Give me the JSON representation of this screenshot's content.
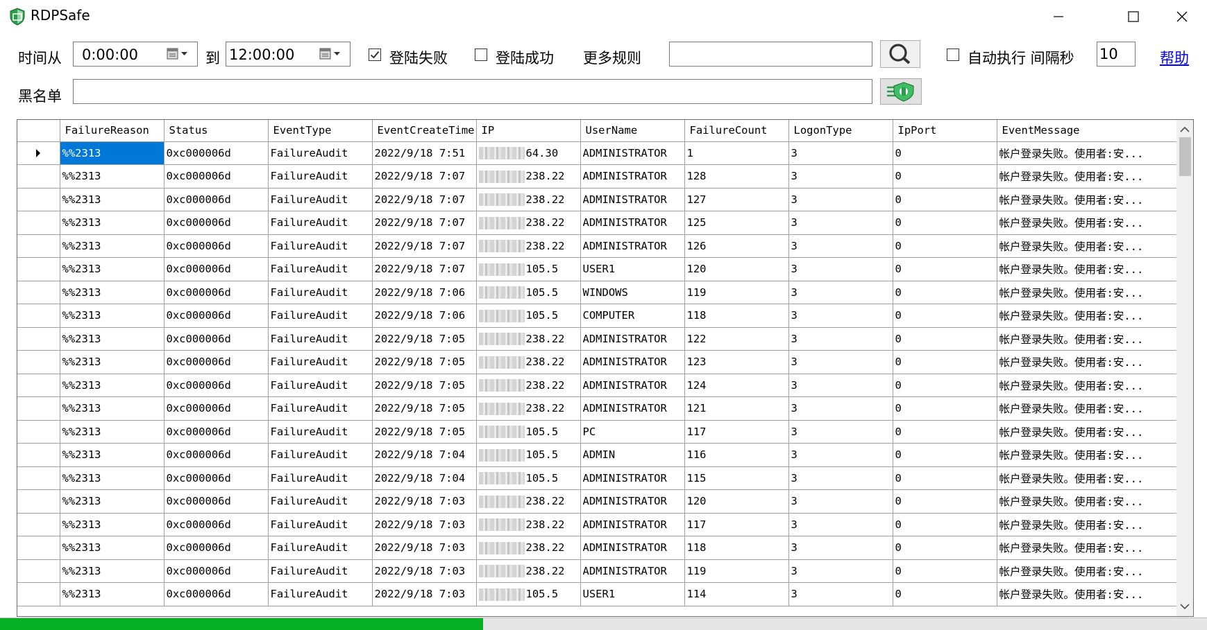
{
  "window": {
    "title": "RDPSafe"
  },
  "toolbar": {
    "time_from_label": "时间从",
    "time_from_value": "0:00:00",
    "to_label": "到",
    "time_to_value": "12:00:00",
    "login_failed_label": "登陆失败",
    "login_failed_checked": true,
    "login_success_label": "登陆成功",
    "login_success_checked": false,
    "more_rules_label": "更多规则",
    "more_rules_value": "",
    "auto_exec_label": "自动执行 间隔秒",
    "auto_exec_checked": false,
    "interval_value": "10",
    "help_label": "帮助",
    "blacklist_label": "黑名单",
    "blacklist_value": ""
  },
  "grid": {
    "columns": [
      "FailureReason",
      "Status",
      "EventType",
      "EventCreateTime",
      "IP",
      "UserName",
      "FailureCount",
      "LogonType",
      "IpPort",
      "EventMessage"
    ],
    "rows": [
      [
        "%%2313",
        "0xc000006d",
        "FailureAudit",
        "2022/9/18 7:51",
        "64.30",
        "ADMINISTRATOR",
        "1",
        "3",
        "0",
        "帐户登录失败。使用者:安..."
      ],
      [
        "%%2313",
        "0xc000006d",
        "FailureAudit",
        "2022/9/18 7:07",
        "238.22",
        "ADMINISTRATOR",
        "128",
        "3",
        "0",
        "帐户登录失败。使用者:安..."
      ],
      [
        "%%2313",
        "0xc000006d",
        "FailureAudit",
        "2022/9/18 7:07",
        "238.22",
        "ADMINISTRATOR",
        "127",
        "3",
        "0",
        "帐户登录失败。使用者:安..."
      ],
      [
        "%%2313",
        "0xc000006d",
        "FailureAudit",
        "2022/9/18 7:07",
        "238.22",
        "ADMINISTRATOR",
        "125",
        "3",
        "0",
        "帐户登录失败。使用者:安..."
      ],
      [
        "%%2313",
        "0xc000006d",
        "FailureAudit",
        "2022/9/18 7:07",
        "238.22",
        "ADMINISTRATOR",
        "126",
        "3",
        "0",
        "帐户登录失败。使用者:安..."
      ],
      [
        "%%2313",
        "0xc000006d",
        "FailureAudit",
        "2022/9/18 7:07",
        "105.5",
        "USER1",
        "120",
        "3",
        "0",
        "帐户登录失败。使用者:安..."
      ],
      [
        "%%2313",
        "0xc000006d",
        "FailureAudit",
        "2022/9/18 7:06",
        "105.5",
        "WINDOWS",
        "119",
        "3",
        "0",
        "帐户登录失败。使用者:安..."
      ],
      [
        "%%2313",
        "0xc000006d",
        "FailureAudit",
        "2022/9/18 7:06",
        "105.5",
        "COMPUTER",
        "118",
        "3",
        "0",
        "帐户登录失败。使用者:安..."
      ],
      [
        "%%2313",
        "0xc000006d",
        "FailureAudit",
        "2022/9/18 7:05",
        "238.22",
        "ADMINISTRATOR",
        "122",
        "3",
        "0",
        "帐户登录失败。使用者:安..."
      ],
      [
        "%%2313",
        "0xc000006d",
        "FailureAudit",
        "2022/9/18 7:05",
        "238.22",
        "ADMINISTRATOR",
        "123",
        "3",
        "0",
        "帐户登录失败。使用者:安..."
      ],
      [
        "%%2313",
        "0xc000006d",
        "FailureAudit",
        "2022/9/18 7:05",
        "238.22",
        "ADMINISTRATOR",
        "124",
        "3",
        "0",
        "帐户登录失败。使用者:安..."
      ],
      [
        "%%2313",
        "0xc000006d",
        "FailureAudit",
        "2022/9/18 7:05",
        "238.22",
        "ADMINISTRATOR",
        "121",
        "3",
        "0",
        "帐户登录失败。使用者:安..."
      ],
      [
        "%%2313",
        "0xc000006d",
        "FailureAudit",
        "2022/9/18 7:05",
        "105.5",
        "PC",
        "117",
        "3",
        "0",
        "帐户登录失败。使用者:安..."
      ],
      [
        "%%2313",
        "0xc000006d",
        "FailureAudit",
        "2022/9/18 7:04",
        "105.5",
        "ADMIN",
        "116",
        "3",
        "0",
        "帐户登录失败。使用者:安..."
      ],
      [
        "%%2313",
        "0xc000006d",
        "FailureAudit",
        "2022/9/18 7:04",
        "105.5",
        "ADMINISTRATOR",
        "115",
        "3",
        "0",
        "帐户登录失败。使用者:安..."
      ],
      [
        "%%2313",
        "0xc000006d",
        "FailureAudit",
        "2022/9/18 7:03",
        "238.22",
        "ADMINISTRATOR",
        "120",
        "3",
        "0",
        "帐户登录失败。使用者:安..."
      ],
      [
        "%%2313",
        "0xc000006d",
        "FailureAudit",
        "2022/9/18 7:03",
        "238.22",
        "ADMINISTRATOR",
        "117",
        "3",
        "0",
        "帐户登录失败。使用者:安..."
      ],
      [
        "%%2313",
        "0xc000006d",
        "FailureAudit",
        "2022/9/18 7:03",
        "238.22",
        "ADMINISTRATOR",
        "118",
        "3",
        "0",
        "帐户登录失败。使用者:安..."
      ],
      [
        "%%2313",
        "0xc000006d",
        "FailureAudit",
        "2022/9/18 7:03",
        "238.22",
        "ADMINISTRATOR",
        "119",
        "3",
        "0",
        "帐户登录失败。使用者:安..."
      ],
      [
        "%%2313",
        "0xc000006d",
        "FailureAudit",
        "2022/9/18 7:03",
        "105.5",
        "USER1",
        "114",
        "3",
        "0",
        "帐户登录失败。使用者:安..."
      ]
    ],
    "selected_row": 0,
    "selected_col": 0
  },
  "progress": {
    "fraction": 0.4
  },
  "icons": {
    "app": "shield-icon",
    "search": "search-icon",
    "blacklist_action": "ip-block-icon",
    "minimize": "minimize-icon",
    "maximize": "maximize-icon",
    "close": "close-icon",
    "calendar": "calendar-dropdown-icon"
  },
  "colors": {
    "selection": "#0078d7",
    "progress": "#06b025",
    "link": "#0000ff",
    "app_icon": "#2a9d4a"
  }
}
